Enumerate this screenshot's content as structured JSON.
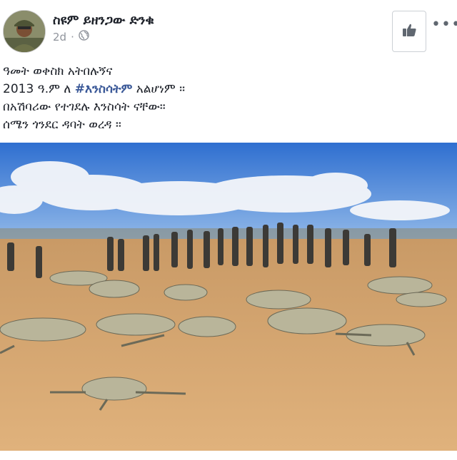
{
  "post": {
    "author_name": "ስዩም ይዘንጋው ድንቁ",
    "timestamp": "2d",
    "separator": "·",
    "privacy_icon": "globe-icon",
    "more_label": "•••",
    "like_icon": "thumbs-up-icon",
    "text_lines": [
      "ዓመት ወቀስክ አትበሉኝና",
      "ለ",
      "#እንስሳትም",
      "አልሆነም ።",
      "በአሽባሪው የተገደሉ እንስሳት  ናቸው።",
      "ሰሜን ጎንደር ዳባት ወረዳ ።"
    ],
    "year_prefix": "2013 ዓ.ም",
    "photo_subject": "dead livestock on dry ground with people standing behind"
  },
  "colors": {
    "hashtag": "#3b5998",
    "meta_gray": "#90949c",
    "sky": "#2f6fd0",
    "ground": "#d6a36a"
  }
}
